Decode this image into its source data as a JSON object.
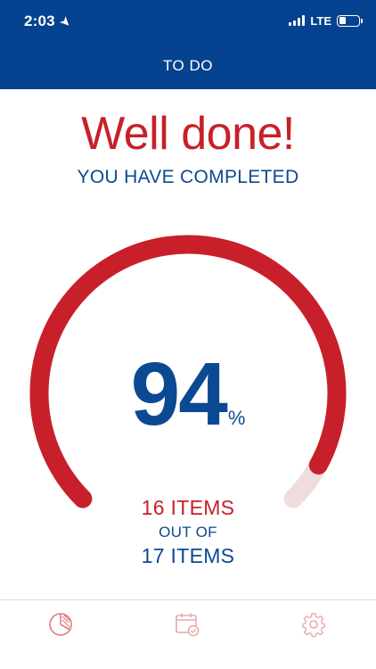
{
  "status_bar": {
    "time": "2:03",
    "network": "LTE",
    "battery_level": 0.35
  },
  "nav": {
    "title": "TO DO"
  },
  "summary": {
    "headline": "Well done!",
    "subheadline": "YOU HAVE COMPLETED",
    "percent_value": "94",
    "percent_sign": "%",
    "completed_line": "16  ITEMS",
    "out_of_line": "OUT OF",
    "total_line": "17  ITEMS",
    "completed_count": 16,
    "total_count": 17,
    "progress_fraction": 0.94
  },
  "colors": {
    "brand_blue": "#05428f",
    "text_blue": "#0b4a92",
    "accent_red": "#c8202a",
    "track_pink": "#f0dcdd",
    "tab_icon": "#e07b7f"
  },
  "tabs": [
    {
      "icon": "pie-chart-icon",
      "active": true
    },
    {
      "icon": "calendar-check-icon",
      "active": false
    },
    {
      "icon": "gear-icon",
      "active": false
    }
  ]
}
